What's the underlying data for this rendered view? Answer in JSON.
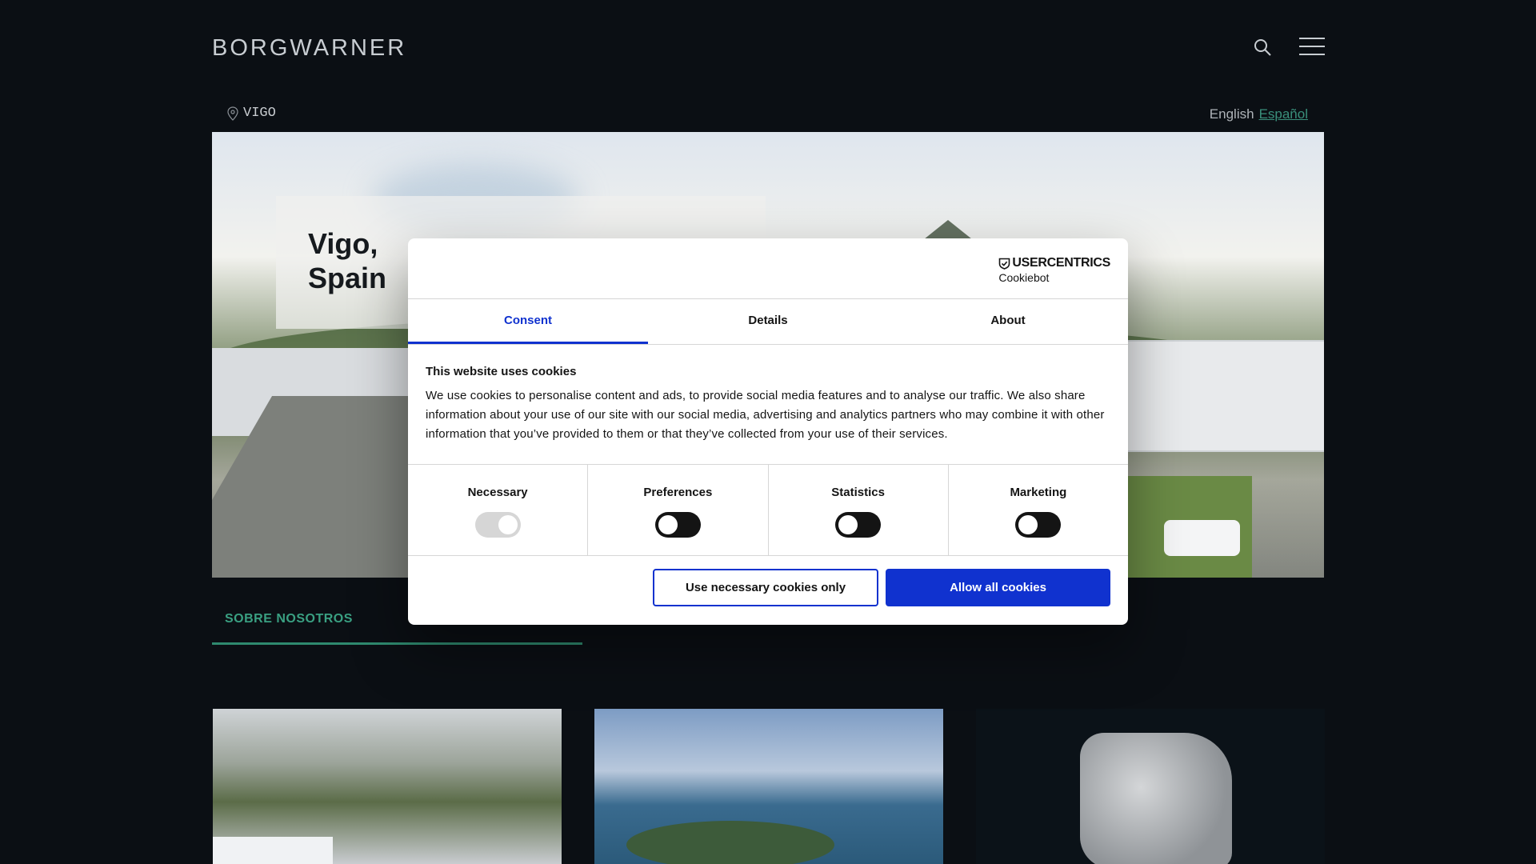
{
  "header": {
    "logo": "BORGWARNER"
  },
  "location": {
    "label": "VIGO"
  },
  "language": {
    "english": "English",
    "spanish": "Español"
  },
  "hero": {
    "title_line1": "Vigo,",
    "title_line2": "Spain"
  },
  "subnav": {
    "item": "SOBRE NOSOTROS"
  },
  "cookie_dialog": {
    "brand_main": "USERCENTRICS",
    "brand_sub": "Cookiebot",
    "tabs": [
      "Consent",
      "Details",
      "About"
    ],
    "heading": "This website uses cookies",
    "body": "We use cookies to personalise content and ads, to provide social media features and to analyse our traffic. We also share information about your use of our site with our social media, advertising and analytics partners who may combine it with other information that you’ve provided to them or that they’ve collected from your use of their services.",
    "categories": [
      {
        "label": "Necessary",
        "enabled": true,
        "locked": true
      },
      {
        "label": "Preferences",
        "enabled": false
      },
      {
        "label": "Statistics",
        "enabled": false
      },
      {
        "label": "Marketing",
        "enabled": false
      }
    ],
    "buttons": {
      "necessary_only": "Use necessary cookies only",
      "allow_all": "Allow all cookies"
    }
  },
  "colors": {
    "accent_blue": "#1032cf",
    "accent_green": "#3aa082",
    "page_bg": "#0b0f14"
  }
}
